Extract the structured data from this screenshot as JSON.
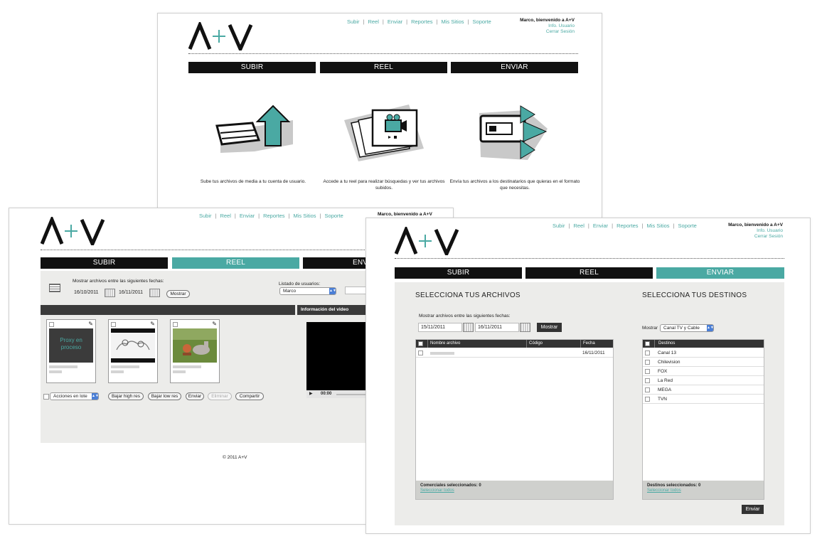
{
  "brand": {
    "logo": "A+V"
  },
  "colors": {
    "accent": "#4aa9a3",
    "dark": "#111111",
    "panel": "#ececea"
  },
  "nav": {
    "subir": "Subir",
    "reel": "Reel",
    "enviar": "Enviar",
    "reportes": "Reportes",
    "missitios": "Mis Sitios",
    "soporte": "Soporte",
    "sep": "|"
  },
  "user": {
    "welcome": "Marco, bienvenido a A+V",
    "info": "Info. Usuario",
    "logout": "Cerrar Sesión"
  },
  "tabs": {
    "subir": "SUBIR",
    "reel": "REEL",
    "enviar": "ENVIAR",
    "enviar_partial": "ENV"
  },
  "home": {
    "features": [
      {
        "icon": "upload-icon",
        "text": "Sube tus archivos de media a tu cuenta de usuario."
      },
      {
        "icon": "reel-icon",
        "text": "Accede a tu reel para realizar búsquedas y ver tus archivos subidos."
      },
      {
        "icon": "send-icon",
        "text": "Envía tus archivos a los destinatarios que quieras en el formato que necesitas."
      }
    ]
  },
  "reel": {
    "date_prompt": "Mostrar archivos entre las siguientes fechas:",
    "date_from": "16/10/2011",
    "date_to": "16/11/2011",
    "show_button": "Mostrar",
    "users_label": "Listado de usuarios:",
    "users_selected": "Marco",
    "video_info": "Información del video",
    "proxy_text": "Proxy en proceso",
    "time": "00:00",
    "batch_select": "Acciones en lote",
    "actions": [
      "Bajar high res",
      "Bajar low res",
      "Enviar",
      "Eliminar",
      "Compartir"
    ],
    "copyright": "© 2011 A+V"
  },
  "send": {
    "files_title": "SELECCIONA TUS ARCHIVOS",
    "dest_title": "SELECCIONA TUS DESTINOS",
    "date_prompt": "Mostrar archivos entre las siguientes fechas:",
    "date_from": "15/11/2011",
    "date_to": "16/11/2011",
    "show_button": "Mostrar",
    "columns": {
      "name": "Nombre archivo",
      "code": "Código",
      "date": "Fecha"
    },
    "file_rows": [
      {
        "date": "16/11/2011"
      }
    ],
    "files_selected": "Comerciales seleccionados: 0",
    "select_all": "Seleccionar todos",
    "dest_show_label": "Mostrar",
    "dest_filter": "Canal TV y Cable",
    "dest_header": "Destinos",
    "destinations": [
      "Canal 13",
      "Chilevision",
      "FOX",
      "La Red",
      "MEGA",
      "TVN"
    ],
    "dest_selected": "Destinos seleccionados: 0",
    "dest_select_all": "Seleccionar todos",
    "submit": "Enviar"
  }
}
